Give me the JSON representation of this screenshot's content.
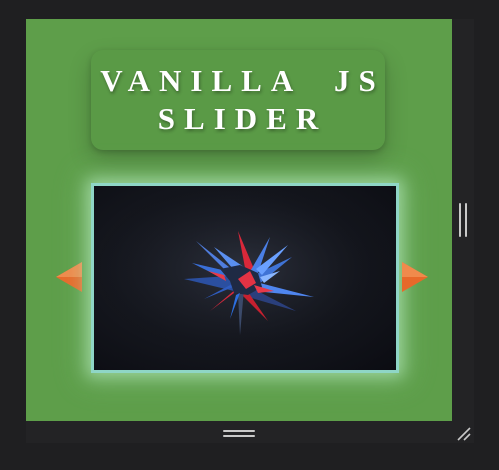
{
  "title": {
    "line1": "VANILLA  JS",
    "line2": "SLIDER"
  },
  "slider": {
    "image_alt": "abstract crystal shards artwork",
    "prev_icon": "triangle-left-icon",
    "next_icon": "triangle-right-icon"
  },
  "colors": {
    "background": "#5e9e4a",
    "title_panel": "#5a9a46",
    "slide_border": "#8fd6c6",
    "arrow": "#e8692a",
    "window_chrome": "#232325"
  }
}
